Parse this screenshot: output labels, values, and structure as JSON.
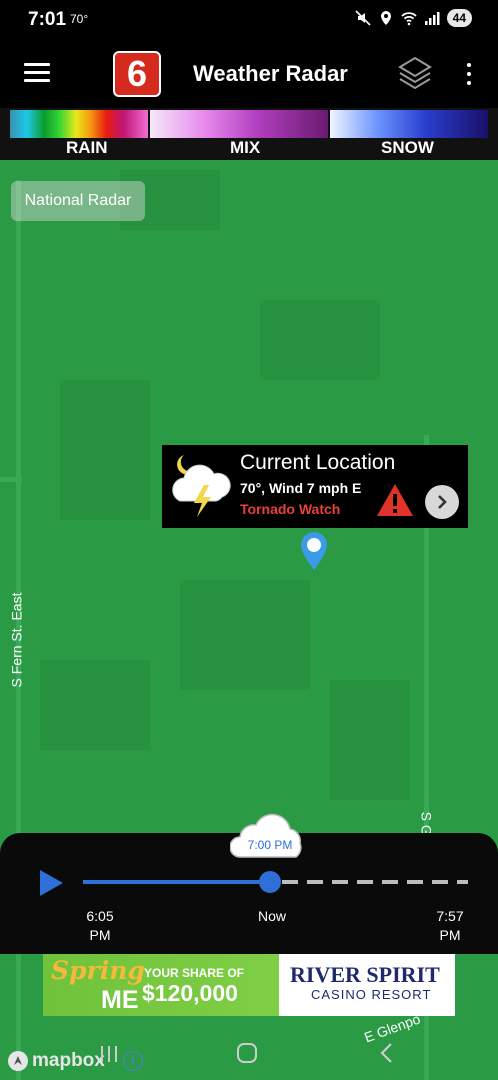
{
  "status_bar": {
    "time": "7:01",
    "temp": "70°",
    "battery": "44",
    "icons": [
      "mute-icon",
      "location-icon",
      "wifi-icon",
      "signal-icon"
    ]
  },
  "app_bar": {
    "title": "Weather Radar",
    "logo_text": "6",
    "accent": "#d52b1e"
  },
  "legend": {
    "rain_label": "RAIN",
    "mix_label": "MIX",
    "snow_label": "SNOW"
  },
  "map": {
    "national_button": "National Radar",
    "street_left": "S Fern St. East",
    "street_right": "S Gen St",
    "street_bottom": "E Glenpo",
    "map_color": "#2a9a44"
  },
  "location_popup": {
    "title": "Current Location",
    "wind": "70°, Wind 7 mph E",
    "alert": "Tornado Watch",
    "alert_color": "#e8403a",
    "weather_icon": "thunderstorm-night-icon"
  },
  "playback": {
    "current_time": "7:00 PM",
    "start_time": "6:05",
    "start_period": "PM",
    "now_label": "Now",
    "end_time": "7:57",
    "end_period": "PM",
    "progress": 0.45,
    "accent": "#2f6fd8"
  },
  "ad": {
    "headline": "Spring",
    "me": "ME",
    "your_share": "YOUR SHARE OF",
    "amount": "$120,000",
    "brand": "RIVER SPIRIT",
    "brand_sub": "CASINO RESORT"
  },
  "footer": {
    "mapbox": "mapbox",
    "info": "i"
  }
}
